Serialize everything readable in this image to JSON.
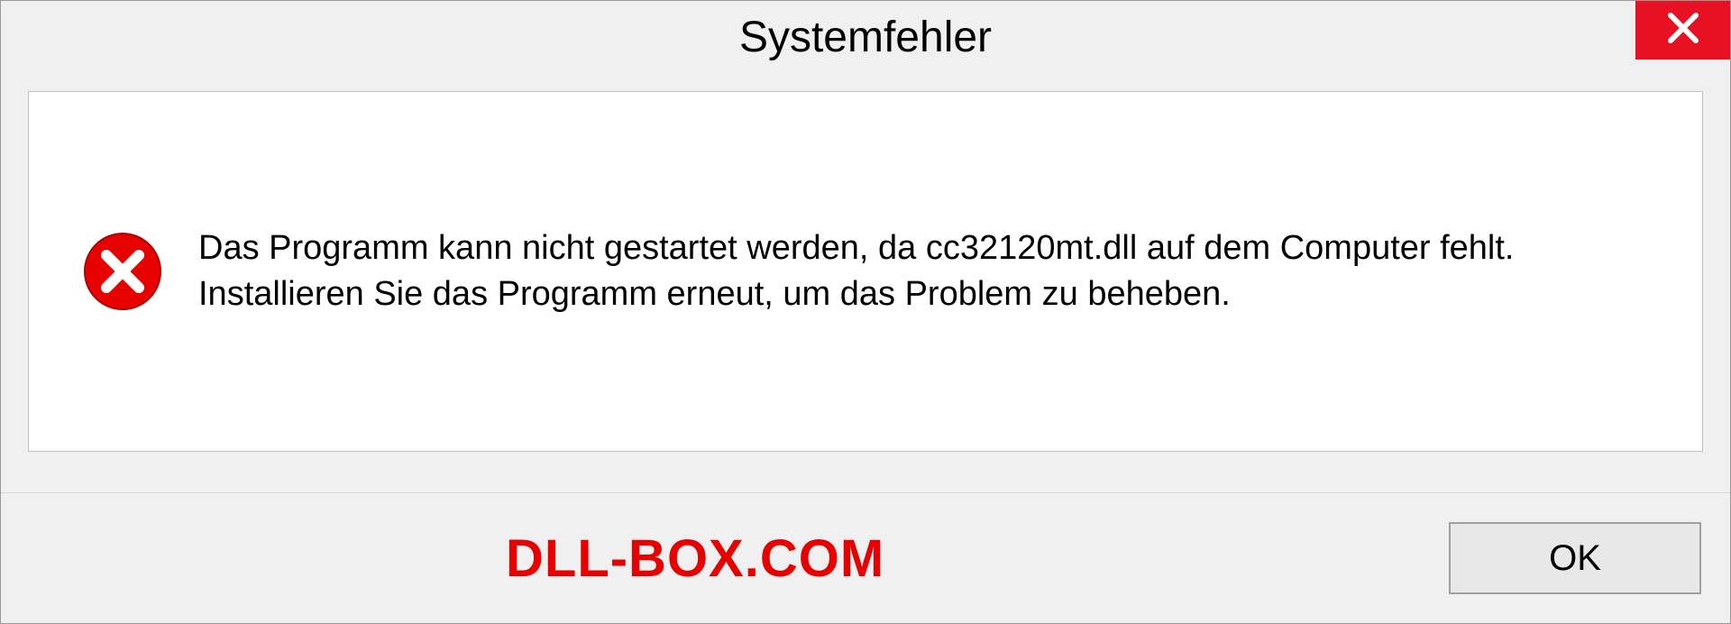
{
  "dialog": {
    "title": "Systemfehler",
    "message": "Das Programm kann nicht gestartet werden, da cc32120mt.dll auf dem Computer fehlt. Installieren Sie das Programm erneut, um das Problem zu beheben.",
    "ok_label": "OK"
  },
  "watermark": "DLL-BOX.COM"
}
